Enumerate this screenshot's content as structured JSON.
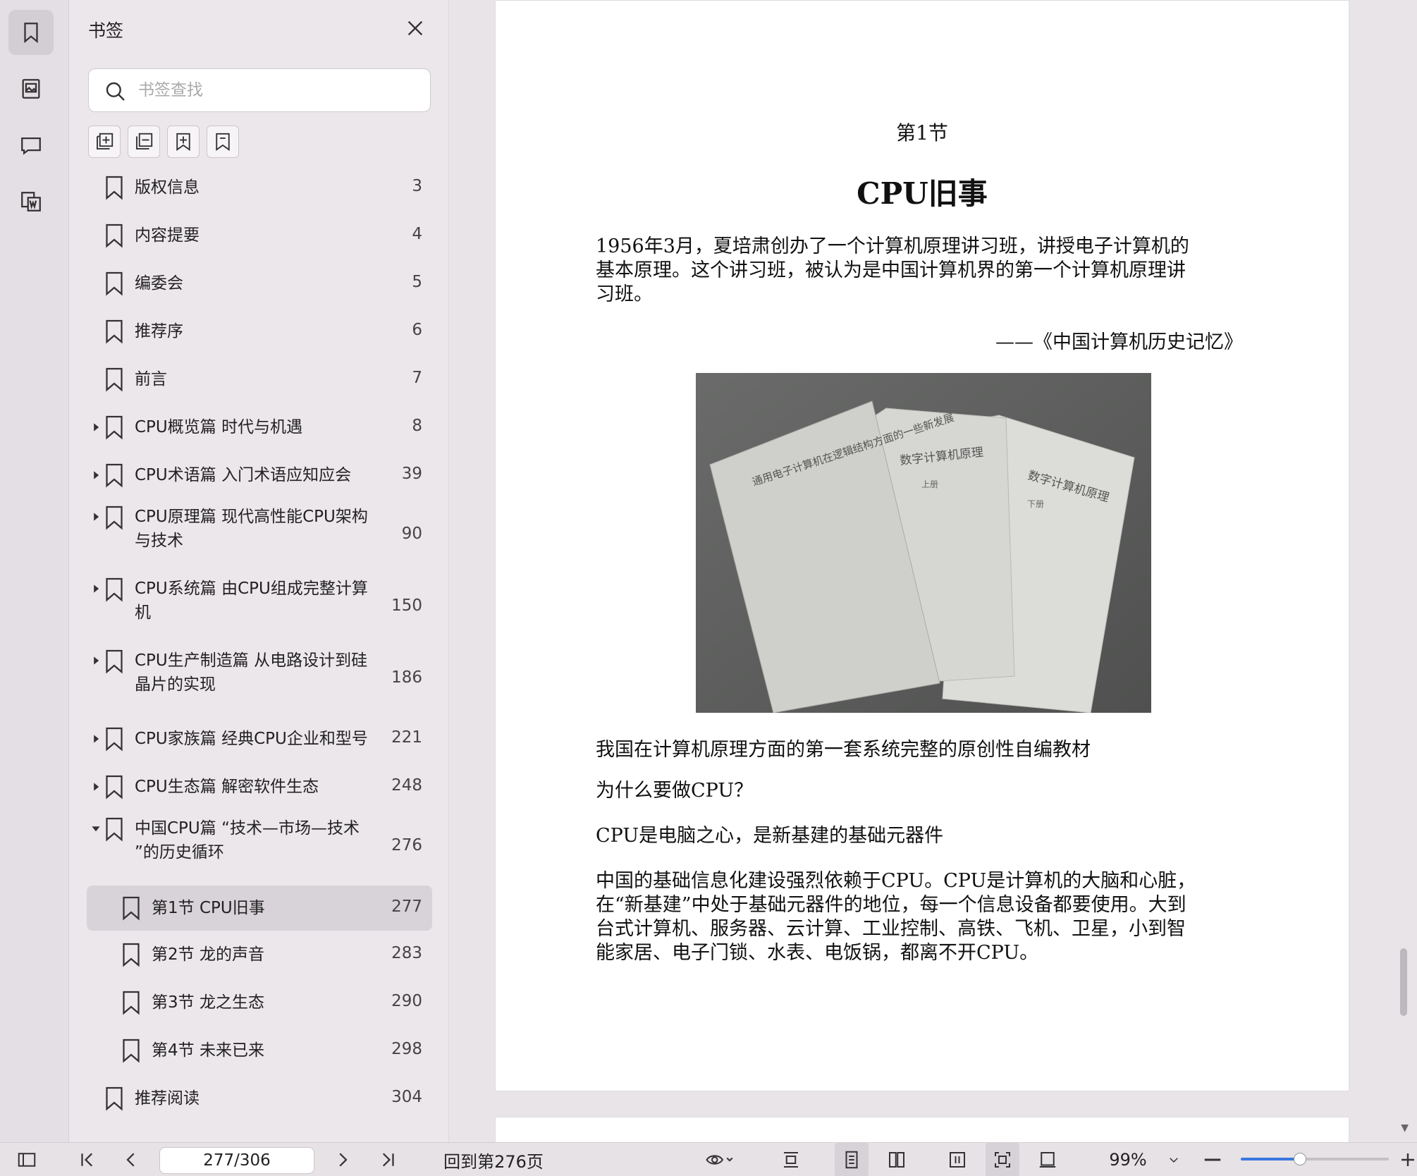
{
  "sidebar_rail": {
    "items": [
      {
        "name": "bookmark-icon",
        "active": true
      },
      {
        "name": "thumbnail-icon",
        "active": false
      },
      {
        "name": "comment-icon",
        "active": false
      },
      {
        "name": "convert-word-icon",
        "active": false
      }
    ]
  },
  "bookmarks": {
    "title": "书签",
    "search_placeholder": "书签查找",
    "tools": [
      "add-bookmark-icon",
      "remove-bookmark-icon",
      "add-child-bookmark-icon",
      "bookmark-outline-icon"
    ],
    "items": [
      {
        "label": "版权信息",
        "page": "3",
        "level": 0,
        "expander": "none"
      },
      {
        "label": "内容提要",
        "page": "4",
        "level": 0,
        "expander": "none"
      },
      {
        "label": "编委会",
        "page": "5",
        "level": 0,
        "expander": "none"
      },
      {
        "label": "推荐序",
        "page": "6",
        "level": 0,
        "expander": "none"
      },
      {
        "label": "前言",
        "page": "7",
        "level": 0,
        "expander": "none"
      },
      {
        "label": "CPU概览篇 时代与机遇",
        "page": "8",
        "level": 0,
        "expander": "collapsed"
      },
      {
        "label": "CPU术语篇 入门术语应知应会",
        "page": "39",
        "level": 0,
        "expander": "collapsed"
      },
      {
        "label": "CPU原理篇 现代高性能CPU架构",
        "label2": "与技术",
        "page": "90",
        "level": 0,
        "expander": "collapsed"
      },
      {
        "label": "CPU系统篇 由CPU组成完整计算",
        "label2": "机",
        "page": "150",
        "level": 0,
        "expander": "collapsed"
      },
      {
        "label": "CPU生产制造篇 从电路设计到硅",
        "label2": "晶片的实现",
        "page": "186",
        "level": 0,
        "expander": "collapsed"
      },
      {
        "label": "CPU家族篇 经典CPU企业和型号",
        "page": "221",
        "level": 0,
        "expander": "collapsed"
      },
      {
        "label": "CPU生态篇 解密软件生态",
        "page": "248",
        "level": 0,
        "expander": "collapsed"
      },
      {
        "label": "中国CPU篇 “技术—市场—技术",
        "label2": "”的历史循环",
        "page": "276",
        "level": 0,
        "expander": "expanded"
      },
      {
        "label": "第1节 CPU旧事",
        "page": "277",
        "level": 1,
        "expander": "none",
        "selected": true
      },
      {
        "label": "第2节 龙的声音",
        "page": "283",
        "level": 1,
        "expander": "none"
      },
      {
        "label": "第3节 龙之生态",
        "page": "290",
        "level": 1,
        "expander": "none"
      },
      {
        "label": "第4节 未来已来",
        "page": "298",
        "level": 1,
        "expander": "none"
      },
      {
        "label": "推荐阅读",
        "page": "304",
        "level": 0,
        "expander": "none"
      }
    ]
  },
  "document": {
    "section_label": "第1节",
    "section_title": "CPU旧事",
    "quote_lines": [
      "1956年3月，夏培肃创办了一个计算机原理讲习班，讲授电子计算机的",
      "基本原理。这个讲习班，被认为是中国计算机界的第一个计算机原理讲",
      "习班。"
    ],
    "quote_source": "——《中国计算机历史记忆》",
    "photo_texts": [
      "通用电子计算机在逻辑结构方面的一些新发展",
      "数字计算机原理",
      "上册",
      "数字计算机原理",
      "下册"
    ],
    "caption": "我国在计算机原理方面的第一套系统完整的原创性自编教材",
    "heading_q": "为什么要做CPU？",
    "heading_a": "CPU是电脑之心，是新基建的基础元器件",
    "body_lines": [
      "中国的基础信息化建设强烈依赖于CPU。CPU是计算机的大脑和心脏，",
      "在“新基建”中处于基础元器件的地位，每一个信息设备都要使用。大到",
      "台式计算机、服务器、云计算、工业控制、高铁、飞机、卫星，小到智",
      "能家居、电子门锁、水表、电饭锅，都离不开CPU。"
    ]
  },
  "statusbar": {
    "page_value": "277/306",
    "back_to": "回到第276页",
    "zoom": "99%",
    "zoom_fraction": 0.4
  },
  "colors": {
    "accent": "#3a78e0",
    "selected_row": "#d8d3d8"
  }
}
